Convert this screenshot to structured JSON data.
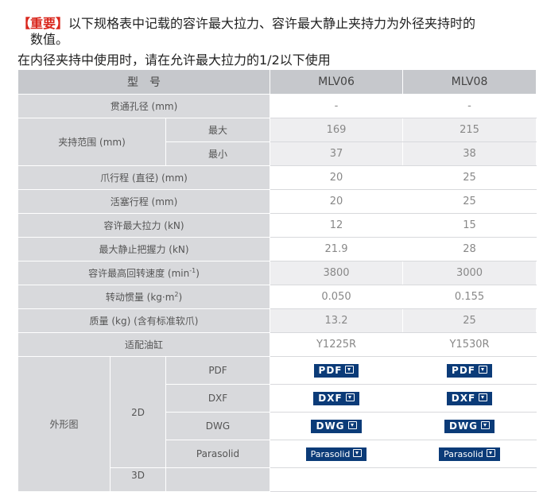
{
  "notice": {
    "important_tag": "【重要】",
    "line1": "以下规格表中记载的容许最大拉力、容许最大静止夹持力为外径夹持时的",
    "line1_cont": "数值。",
    "line2": "在内径夹持中使用时，请在允许最大拉力的1/2以下使用"
  },
  "table": {
    "header": {
      "label": "型　号",
      "models": [
        "MLV06",
        "MLV08"
      ]
    },
    "rows": {
      "bore": {
        "label": "贯通孔径 (mm)",
        "values": [
          "-",
          "-"
        ]
      },
      "grip_range": {
        "label": "夹持范围 (mm)",
        "max_label": "最大",
        "max_values": [
          "169",
          "215"
        ],
        "min_label": "最小",
        "min_values": [
          "37",
          "38"
        ]
      },
      "jaw_stroke": {
        "label": "爪行程 (直径) (mm)",
        "values": [
          "20",
          "25"
        ]
      },
      "piston_stroke": {
        "label": "活塞行程 (mm)",
        "values": [
          "20",
          "25"
        ]
      },
      "max_pull": {
        "label": "容许最大拉力 (kN)",
        "values": [
          "12",
          "15"
        ]
      },
      "max_static_grip": {
        "label": "最大静止把握力 (kN)",
        "values": [
          "21.9",
          "28"
        ]
      },
      "max_speed": {
        "label_main": "容许最高回转速度 (min",
        "label_sup": "-1",
        "label_end": ")",
        "values": [
          "3800",
          "3000"
        ]
      },
      "inertia": {
        "label_main": "转动惯量 (kg·m",
        "label_sup": "2",
        "label_end": ")",
        "values": [
          "0.050",
          "0.155"
        ]
      },
      "mass": {
        "label": "质量 (kg) (含有标准软爪)",
        "values": [
          "13.2",
          "25"
        ]
      },
      "cylinder": {
        "label": "适配油缸",
        "values": [
          "Y1225R",
          "Y1530R"
        ]
      },
      "drawings": {
        "label": "外形图",
        "group_2d": "2D",
        "group_3d": "3D",
        "formats": [
          "PDF",
          "DXF",
          "DWG",
          "Parasolid"
        ],
        "buttons": [
          "PDF",
          "DXF",
          "DWG",
          "Parasolid"
        ]
      }
    }
  },
  "colors": {
    "header_bg": "#c6c8cc",
    "label_bg": "#d8d9dc",
    "button_bg": "#0b3b78",
    "important": "#d9261c"
  },
  "icons": {
    "download": "download-icon"
  }
}
